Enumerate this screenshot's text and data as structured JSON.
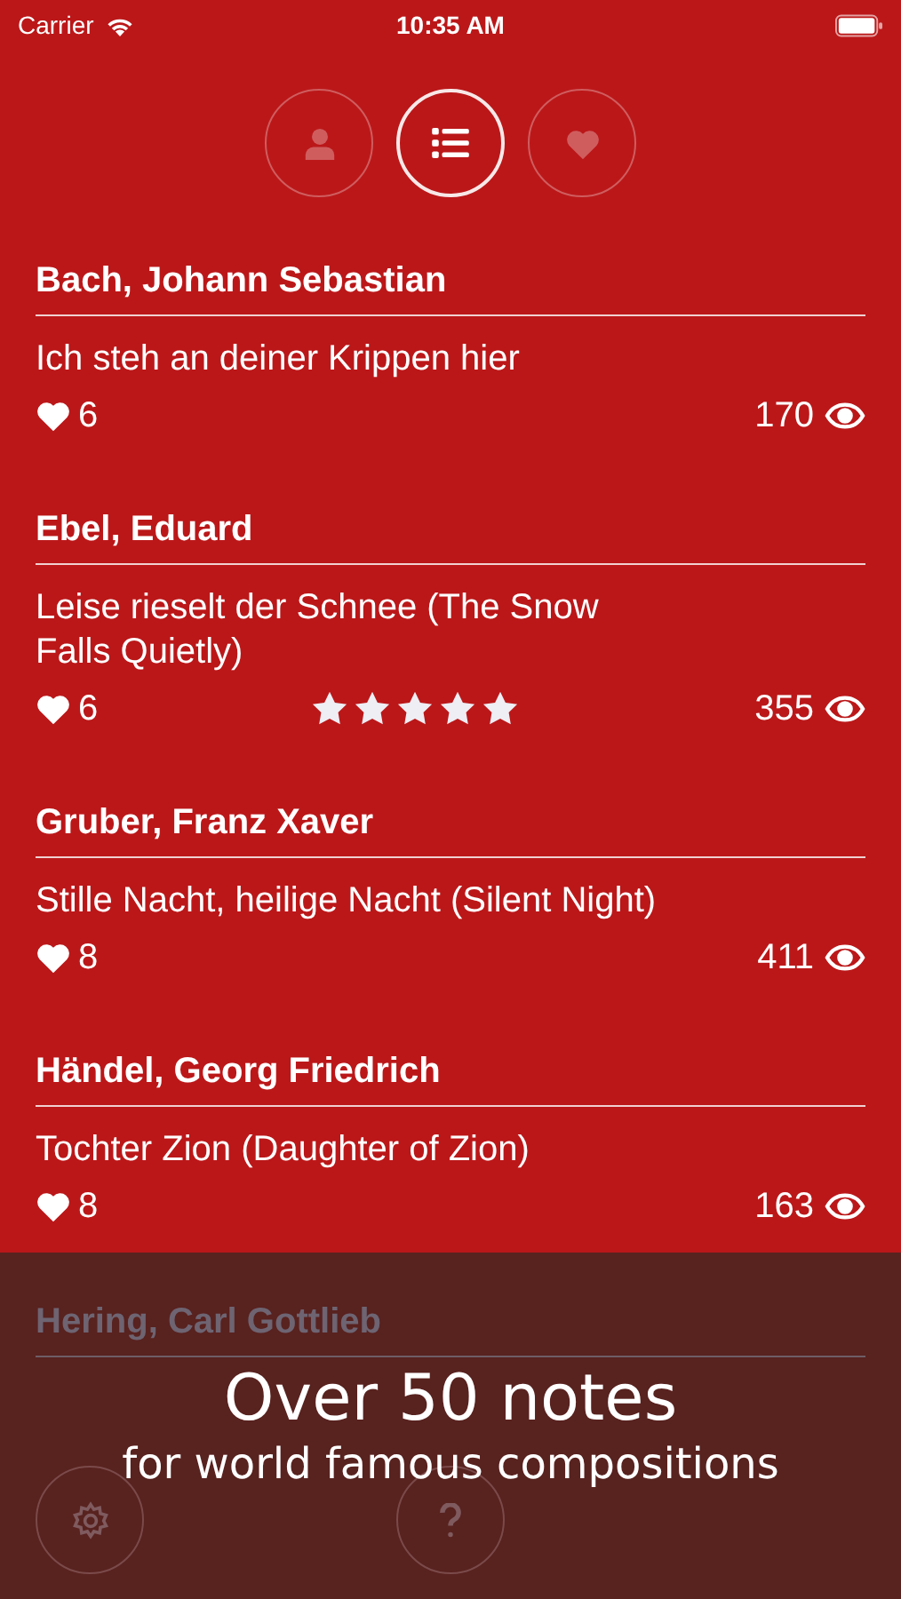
{
  "status_bar": {
    "carrier": "Carrier",
    "time": "10:35 AM"
  },
  "tabs": [
    {
      "kind": "person",
      "selected": false
    },
    {
      "kind": "list",
      "selected": true
    },
    {
      "kind": "heart",
      "selected": false
    }
  ],
  "songs": [
    {
      "composer": "Bach, Johann Sebastian",
      "title": "Ich steh an deiner Krippen hier",
      "likes": "6",
      "views": "170"
    },
    {
      "composer": "Ebel, Eduard",
      "title": "Leise rieselt der Schnee (The Snow Falls Quietly)",
      "likes": "6",
      "views": "355",
      "stars": 5
    },
    {
      "composer": "Gruber, Franz Xaver",
      "title": "Stille Nacht, heilige Nacht (Silent Night)",
      "likes": "8",
      "views": "411"
    },
    {
      "composer": "Händel, Georg Friedrich",
      "title": "Tochter Zion (Daughter of Zion)",
      "likes": "8",
      "views": "163"
    }
  ],
  "promo": {
    "dimmed_composer": "Hering, Carl Gottlieb",
    "headline": "Over 50 notes",
    "subline": "for world famous compositions"
  }
}
